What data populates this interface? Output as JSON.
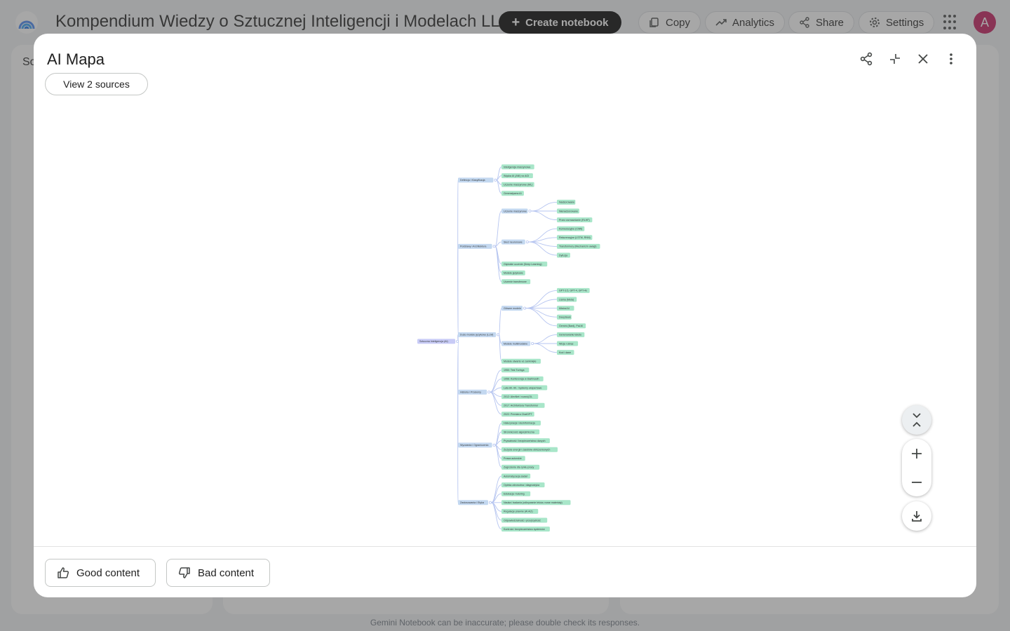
{
  "app": {
    "title": "Kompendium Wiedzy o Sztucznej Inteligencji i Modelach LLM",
    "create_label": "Create notebook",
    "copy_label": "Copy",
    "analytics_label": "Analytics",
    "share_label": "Share",
    "settings_label": "Settings",
    "avatar_initial": "A",
    "disclaimer": "Gemini Notebook can be inaccurate; please double check its responses.",
    "sources_header_fragment": "So"
  },
  "modal": {
    "title": "AI Mapa",
    "view_sources_label": "View 2 sources",
    "good_content_label": "Good content",
    "bad_content_label": "Bad content"
  },
  "mindmap": {
    "root": "Sztuczna Inteligencja (AI)",
    "branches": [
      {
        "label": "Definicja i Klasyfikacja",
        "children": [
          {
            "label": "Inteligencja maszynowa"
          },
          {
            "label": "Wąska AI (ANI) vs AGI"
          },
          {
            "label": "Uczenie maszynowe (ML)"
          },
          {
            "label": "Generatywna AI"
          }
        ]
      },
      {
        "label": "Podstawy i Architektura",
        "children": [
          {
            "label": "Uczenie maszynowe",
            "children": [
              {
                "label": "Nadzorowane"
              },
              {
                "label": "Nienadzorowane"
              },
              {
                "label": "Przez wzmacnianie (RLHF)"
              }
            ]
          },
          {
            "label": "Sieci neuronowe",
            "children": [
              {
                "label": "Konwolucyjne (CNN)"
              },
              {
                "label": "Rekurencyjne (LSTM, RNN)"
              },
              {
                "label": "Transformery (Mechanizm uwagi)"
              },
              {
                "label": "Dyfuzja"
              }
            ]
          },
          {
            "label": "Głębokie uczenie (Deep Learning)"
          },
          {
            "label": "Modele językowe"
          },
          {
            "label": "Uczenie transferowe"
          }
        ]
      },
      {
        "label": "Duże modele językowe (LLM)",
        "children": [
          {
            "label": "Główne modele",
            "children": [
              {
                "label": "GPT-3.5, GPT-4, GPT-4o"
              },
              {
                "label": "Llama (Meta)"
              },
              {
                "label": "Mistral AI"
              },
              {
                "label": "DeepSeek"
              },
              {
                "label": "Gemini (Bard), PaLM"
              }
            ]
          },
          {
            "label": "Modele multimodalne",
            "children": [
              {
                "label": "Generowanie tekstu"
              },
              {
                "label": "Wizja i obraz"
              },
              {
                "label": "Kod i dane"
              }
            ]
          },
          {
            "label": "Modele otwarte vs zamknięte"
          }
        ]
      },
      {
        "label": "Historia i Przełomy",
        "children": [
          {
            "label": "1950: Test Turinga"
          },
          {
            "label": "1956: Konferencja w Dartmouth"
          },
          {
            "label": "Lata 80.-90.: Systemy ekspertowe"
          },
          {
            "label": "2012: AlexNet i rozwój DL"
          },
          {
            "label": "2017: Architektura Transformer"
          },
          {
            "label": "2022: Premiera ChatGPT"
          }
        ]
      },
      {
        "label": "Wyzwania i Ograniczenia",
        "children": [
          {
            "label": "Halucynacje i dezinformacja"
          },
          {
            "label": "Stronniczość algorytmiczna"
          },
          {
            "label": "Prywatność i bezpieczeństwo danych"
          },
          {
            "label": "Zużycie energii i zasobów obliczeniowych"
          },
          {
            "label": "Prawa autorskie"
          },
          {
            "label": "Zagrożenie dla rynku pracy"
          }
        ]
      },
      {
        "label": "Zastosowania i Etyka",
        "children": [
          {
            "label": "Automatyzacja zadań"
          },
          {
            "label": "Opieka zdrowotna i diagnostyka"
          },
          {
            "label": "Edukacja i tutoring"
          },
          {
            "label": "Nauka i badania (odkrywanie leków, nowe materiały)"
          },
          {
            "label": "Regulacje prawne (AI Act)"
          },
          {
            "label": "Odpowiedzialność i przejrzystość"
          },
          {
            "label": "Kontrola i bezpieczeństwo systemów"
          }
        ]
      }
    ]
  },
  "colors": {
    "root": "#c8cbf6",
    "branch": "#c3d8f0",
    "leaf": "#a8e6c9",
    "link": "#b6c5f0",
    "accent": "#000000"
  }
}
